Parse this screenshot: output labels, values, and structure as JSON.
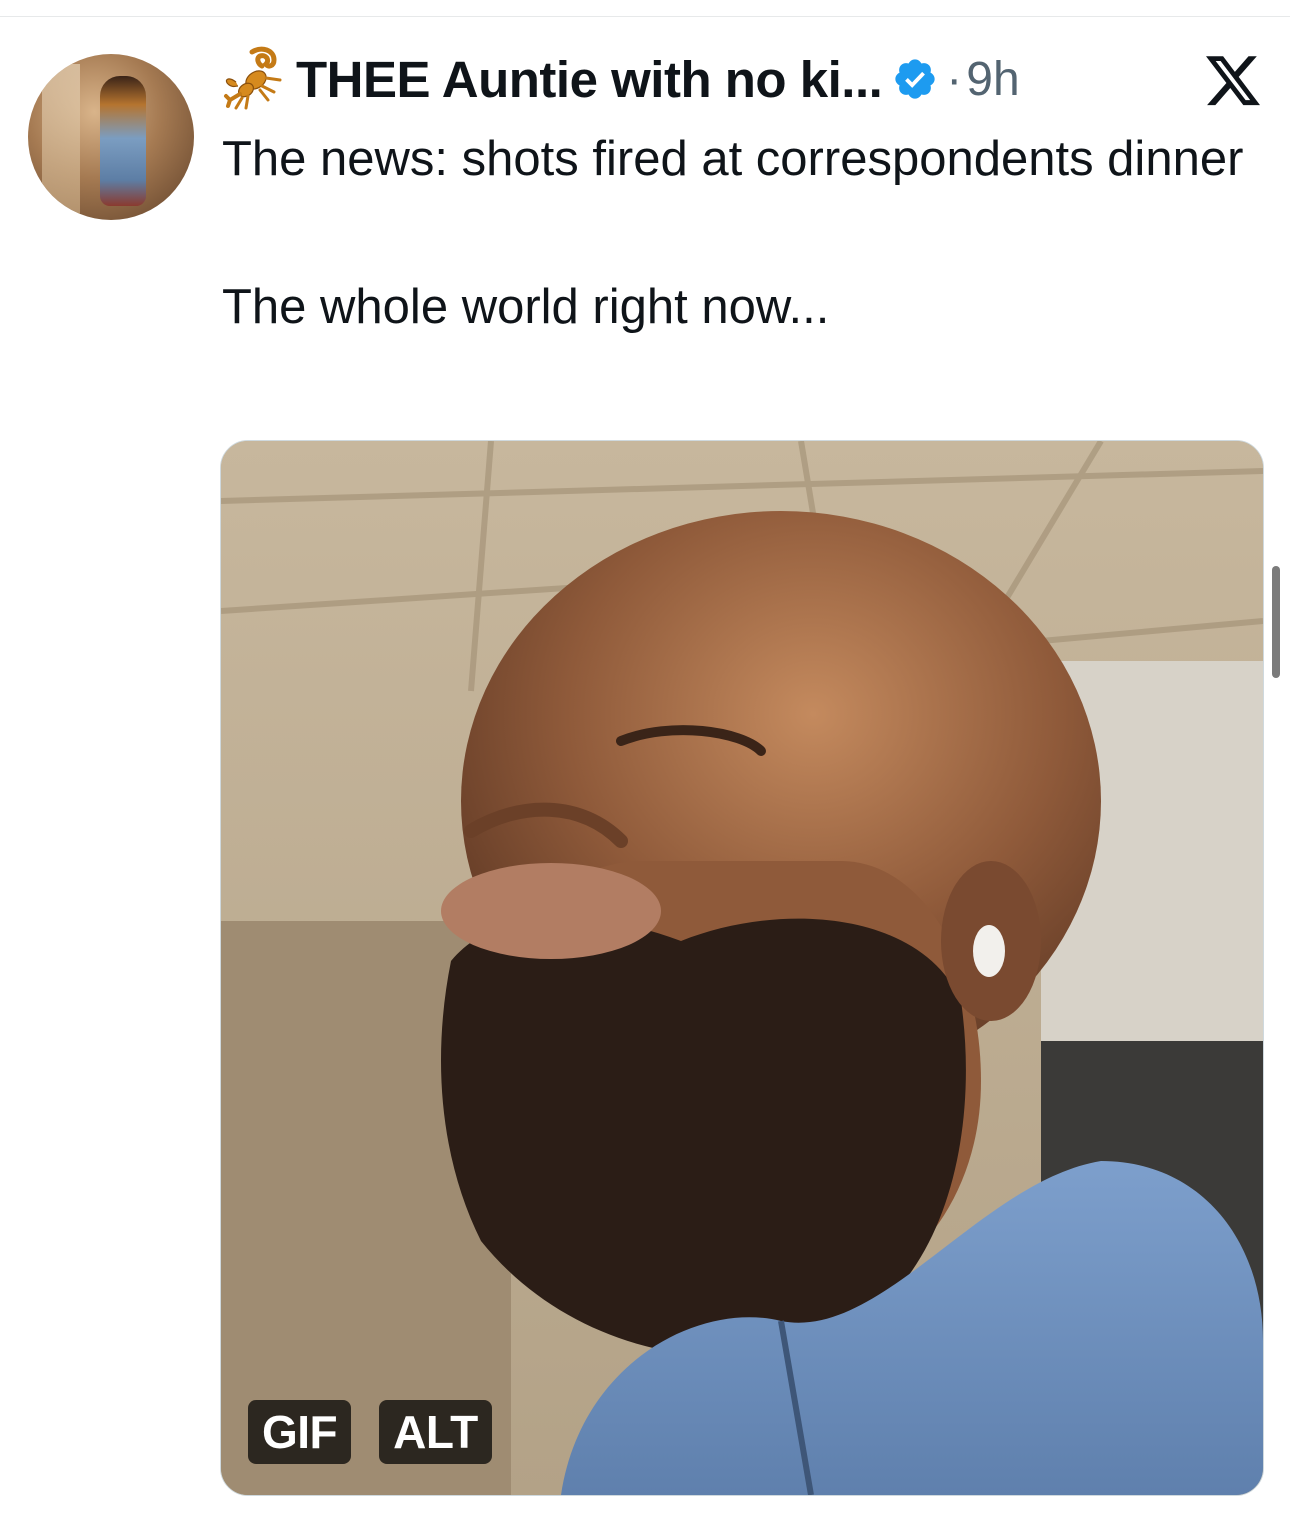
{
  "tweet": {
    "display_name": "THEE Auntie with no ki...",
    "separator": "·",
    "time": "9h",
    "text": "The news: shots fired at correspondents dinner\n\nThe whole world right now...",
    "media": {
      "badges": [
        "GIF",
        "ALT"
      ]
    }
  },
  "icons": {
    "name_emoji": "scorpion-icon",
    "verified": "verified-badge-icon",
    "platform": "x-logo-icon"
  },
  "colors": {
    "text": "#0f1419",
    "secondary": "#536471",
    "verified": "#1d9bf0",
    "badge_bg": "#000000"
  }
}
